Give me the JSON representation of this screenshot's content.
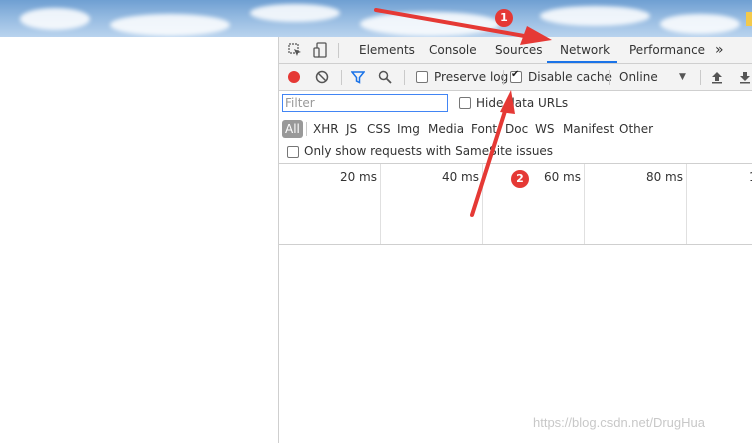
{
  "devtools": {
    "tabs": [
      "Elements",
      "Console",
      "Sources",
      "Network",
      "Performance"
    ],
    "more_tabs": "»",
    "preserve_log_label": "Preserve log",
    "preserve_log_checked": false,
    "disable_cache_label": "Disable cache",
    "disable_cache_checked": true,
    "throttling_value": "Online",
    "filter_placeholder": "Filter",
    "hide_data_urls_label": "Hide data URLs",
    "resource_types": [
      "All",
      "XHR",
      "JS",
      "CSS",
      "Img",
      "Media",
      "Font",
      "Doc",
      "WS",
      "Manifest",
      "Other"
    ],
    "samesite_label": "Only show requests with SameSite issues",
    "timeline_ticks": [
      "20 ms",
      "40 ms",
      "60 ms",
      "80 ms",
      "1"
    ]
  },
  "annotations": {
    "badge1": "1",
    "badge2": "2",
    "color": "#e53935"
  },
  "watermark": "https://blog.csdn.net/DrugHua"
}
